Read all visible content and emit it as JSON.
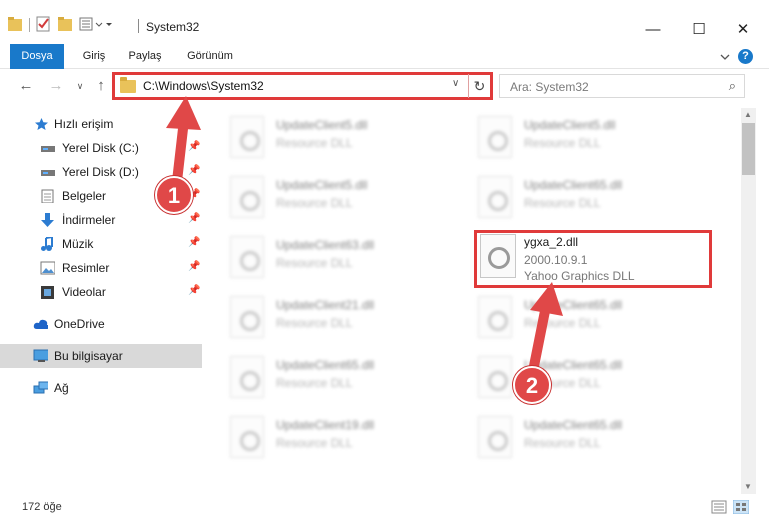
{
  "window": {
    "title": "System32",
    "minimize_glyph": "—",
    "maximize_glyph": "☐",
    "close_glyph": "✕"
  },
  "ribbon": {
    "tabs": [
      {
        "label": "Dosya",
        "active": true
      },
      {
        "label": "Giriş"
      },
      {
        "label": "Paylaş"
      },
      {
        "label": "Görünüm"
      }
    ],
    "help_glyph": "?"
  },
  "address": {
    "path": "C:\\Windows\\System32",
    "dropdown_glyph": "∨",
    "refresh_glyph": "↻"
  },
  "search": {
    "placeholder": "Ara: System32",
    "icon_glyph": "⌕"
  },
  "nav_buttons": {
    "back": "←",
    "forward": "→",
    "recent": "∨",
    "up": "↑"
  },
  "sidebar": {
    "items": [
      {
        "label": "Hızlı erişim",
        "icon": "star-icon"
      },
      {
        "label": "Yerel Disk (C:)",
        "icon": "drive-icon",
        "pinned": true
      },
      {
        "label": "Yerel Disk (D:)",
        "icon": "drive-icon",
        "pinned": true
      },
      {
        "label": "Belgeler",
        "icon": "documents-icon",
        "pinned": true
      },
      {
        "label": "İndirmeler",
        "icon": "download-icon",
        "pinned": true
      },
      {
        "label": "Müzik",
        "icon": "music-icon",
        "pinned": true
      },
      {
        "label": "Resimler",
        "icon": "pictures-icon",
        "pinned": true
      },
      {
        "label": "Videolar",
        "icon": "videos-icon",
        "pinned": true
      },
      {
        "label": "OneDrive",
        "icon": "cloud-icon"
      },
      {
        "label": "Bu bilgisayar",
        "icon": "computer-icon",
        "selected": true
      },
      {
        "label": "Ağ",
        "icon": "network-icon"
      }
    ],
    "pin_glyph": "📌"
  },
  "files": {
    "left_column": [
      {
        "name": "UpdateClient5.dll",
        "type": "Resource DLL"
      },
      {
        "name": "UpdateClient5.dll",
        "type": "Resource DLL"
      },
      {
        "name": "UpdateClient63.dll",
        "type": "Resource DLL"
      },
      {
        "name": "UpdateClient21.dll",
        "type": "Resource DLL"
      },
      {
        "name": "UpdateClient65.dll",
        "type": "Resource DLL"
      },
      {
        "name": "UpdateClient19.dll",
        "type": "Resource DLL"
      }
    ],
    "right_column": [
      {
        "name": "UpdateClient5.dll",
        "type": "Resource DLL"
      },
      {
        "name": "UpdateClient65.dll",
        "type": "Resource DLL"
      },
      {
        "name": "UpdateClient65.dll",
        "type": "Resource DLL"
      },
      {
        "name": "UpdateClient65.dll",
        "type": "Resource DLL"
      },
      {
        "name": "UpdateClient65.dll",
        "type": "Resource DLL"
      }
    ],
    "highlighted": {
      "name": "ygxa_2.dll",
      "version": "2000.10.9.1",
      "description": "Yahoo Graphics DLL"
    }
  },
  "status": {
    "count": "172 öğe"
  },
  "annotations": {
    "step1": "1",
    "step2": "2"
  },
  "colors": {
    "accent": "#1979ca",
    "annotation_red": "#e03a3a"
  }
}
